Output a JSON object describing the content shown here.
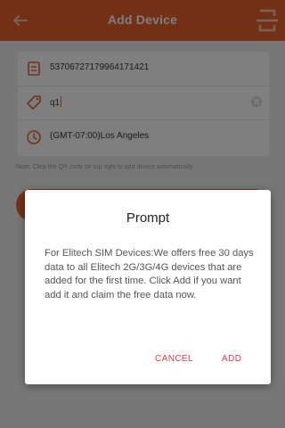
{
  "header": {
    "title": "Add Device",
    "back_icon": "arrow-left-icon",
    "scan_icon": "qr-scan-icon",
    "bg_color": "#e5622e"
  },
  "form": {
    "device_id": {
      "icon": "device-id-icon",
      "value": "53706727179964171421"
    },
    "device_name": {
      "icon": "tag-icon",
      "value": "q1"
    },
    "time_zone": {
      "icon": "clock-icon",
      "value": "(GMT-07:00)Los Angeles"
    },
    "note": "Note: Click the QR code on top right to add device automatically"
  },
  "dialog": {
    "title": "Prompt",
    "message": "For Elitech SIM Devices:We offers free 30 days data to all Elitech 2G/3G/4G devices that are added for the first time. Click Add if you want add it and claim the free data now.",
    "cancel_label": "CANCEL",
    "add_label": "ADD",
    "action_color": "#e53946"
  }
}
